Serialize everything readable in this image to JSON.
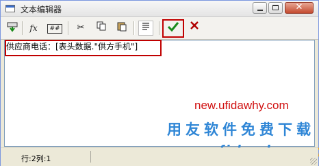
{
  "window": {
    "title": "文本编辑器"
  },
  "toolbar": {
    "fx_label": "fx",
    "field_label": "##"
  },
  "editor": {
    "content": "供应商电话：[表头数据.\"供方手机\"]"
  },
  "watermark": {
    "url_red": "new.ufidawhy.com",
    "slogan": "用友软件免费下载",
    "url_pre": "new.",
    "url_ufi": "ufidawhy",
    "url_post": ".com"
  },
  "status": {
    "position": "行:2列:1"
  },
  "colors": {
    "accent_red": "#c00000",
    "ok_green": "#1a8a1a",
    "cancel_red": "#b00000"
  }
}
